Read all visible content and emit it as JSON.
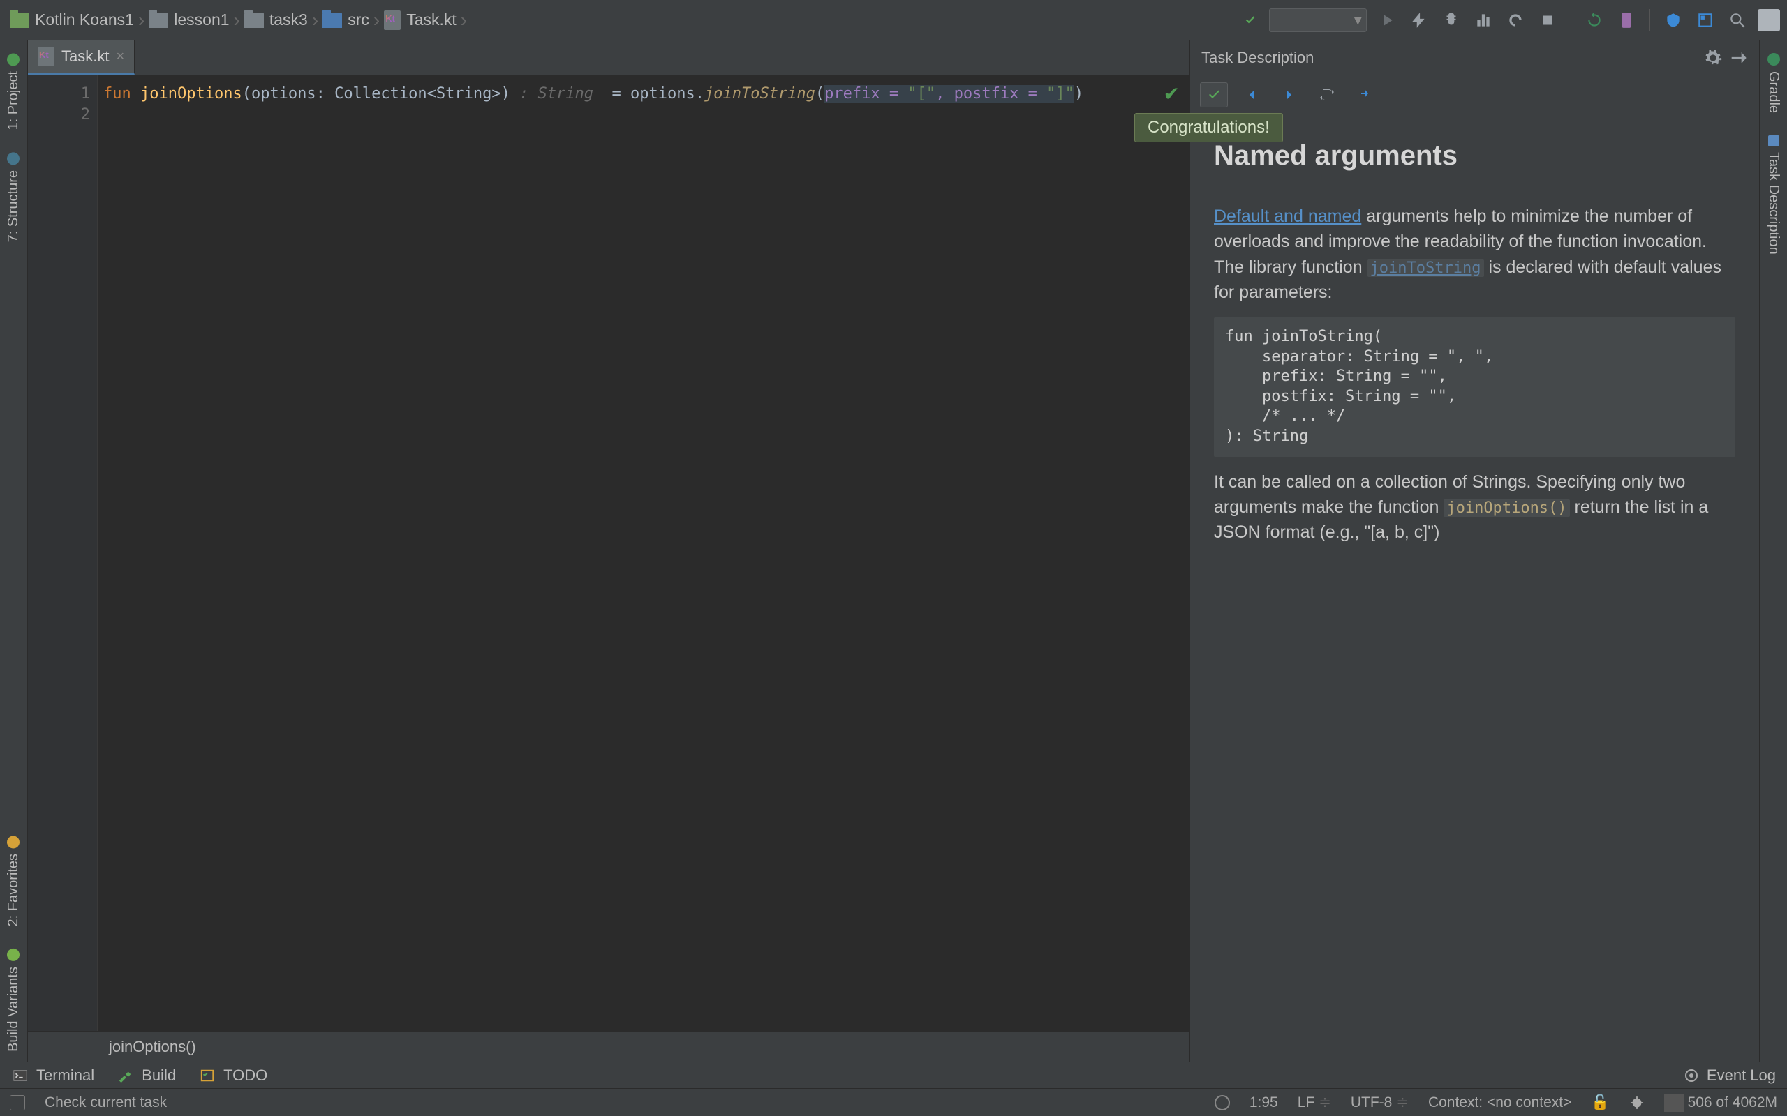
{
  "breadcrumb": [
    "Kotlin Koans1",
    "lesson1",
    "task3",
    "src",
    "Task.kt"
  ],
  "editor": {
    "tab_label": "Task.kt",
    "footer": "joinOptions()",
    "code_tokens": {
      "fun": "fun",
      "name": "joinOptions",
      "sig1": "(options: Collection<String>)",
      "anno": " : String  ",
      "eq": "= options.",
      "call": "joinToString",
      "lp": "(",
      "p1k": "prefix",
      "p1s": " = ",
      "p1v": "\"[\"",
      "comma": ", ",
      "p2k": "postfix",
      "p2s": " = ",
      "p2v": "\"]\"",
      "rp": ")"
    }
  },
  "task": {
    "panel_title": "Task Description",
    "congrats": "Congratulations!",
    "heading": "Named arguments",
    "link1": "Default and named",
    "para1_rest": " arguments help to minimize the number of overloads and improve the readability of the function invocation. The library function ",
    "inline1": "joinToString",
    "para1_tail": " is declared with default values for parameters:",
    "code_block": "fun joinToString(\n    separator: String = \", \",\n    prefix: String = \"\",\n    postfix: String = \"\",\n    /* ... */\n): String",
    "para2_a": "It can be called on a collection of Strings. Specifying only two arguments make the function ",
    "inline2": "joinOptions()",
    "para2_b": " return the list in a JSON format (e.g., \"[a, b, c]\")"
  },
  "left_stripe": {
    "project": "1: Project",
    "structure": "7: Structure",
    "favorites": "2: Favorites",
    "build_variants": "Build Variants"
  },
  "right_stripe": {
    "gradle": "Gradle",
    "task_desc": "Task Description"
  },
  "bottom_tabs": {
    "terminal": "Terminal",
    "build": "Build",
    "todo": "TODO",
    "event_log": "Event Log"
  },
  "status": {
    "msg": "Check current task",
    "pos": "1:95",
    "le": "LF",
    "enc": "UTF-8",
    "ctx": "Context: <no context>",
    "mem": "506 of 4062M"
  }
}
